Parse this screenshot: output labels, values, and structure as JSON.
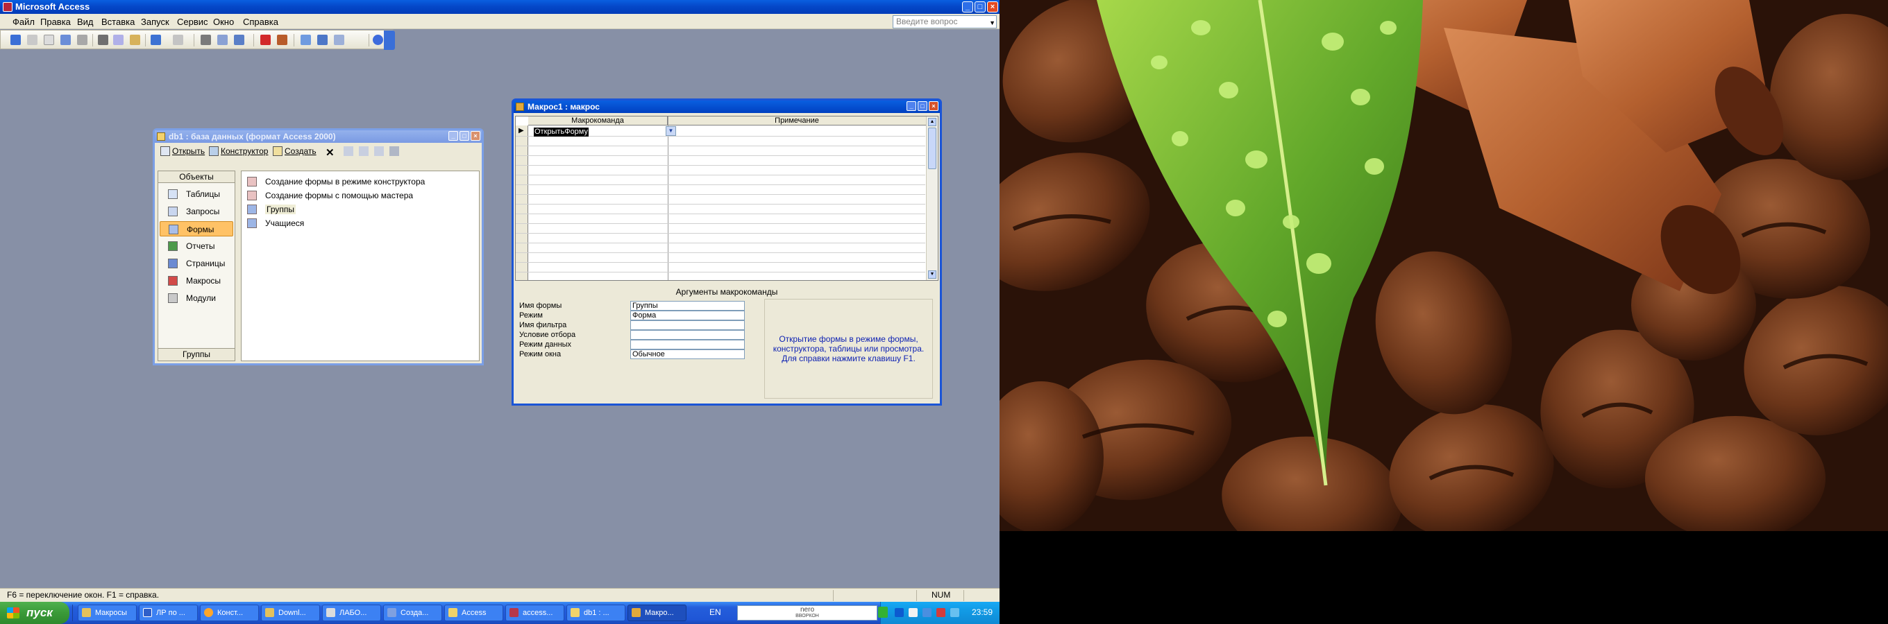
{
  "app": {
    "title": "Microsoft Access"
  },
  "menubar": {
    "items": [
      "Файл",
      "Правка",
      "Вид",
      "Вставка",
      "Запуск",
      "Сервис",
      "Окно",
      "Справка"
    ],
    "help_placeholder": "Введите вопрос"
  },
  "db_window": {
    "title": "db1 : база данных (формат Access 2000)",
    "toolbar": {
      "open": "Открыть",
      "design": "Конструктор",
      "create": "Создать"
    },
    "objects_header": "Объекты",
    "objects": [
      "Таблицы",
      "Запросы",
      "Формы",
      "Отчеты",
      "Страницы",
      "Макросы",
      "Модули"
    ],
    "selected_object": "Формы",
    "groups_label": "Группы",
    "items": [
      "Создание формы в режиме конструктора",
      "Создание формы с помощью мастера",
      "Группы",
      "Учащиеся"
    ]
  },
  "macro_window": {
    "title": "Макрос1 : макрос",
    "col_action": "Макрокоманда",
    "col_note": "Примечание",
    "first_action": "ОткрытьФорму",
    "args_label": "Аргументы макрокоманды",
    "args": [
      {
        "label": "Имя формы",
        "value": "Группы"
      },
      {
        "label": "Режим",
        "value": "Форма"
      },
      {
        "label": "Имя фильтра",
        "value": ""
      },
      {
        "label": "Условие отбора",
        "value": ""
      },
      {
        "label": "Режим данных",
        "value": ""
      },
      {
        "label": "Режим окна",
        "value": "Обычное"
      }
    ],
    "hint": "Открытие формы в режиме формы, конструктора, таблицы или просмотра. Для справки нажмите клавишу F1."
  },
  "statusbar": {
    "text": "F6 = переключение окон.  F1 = справка.",
    "num": "NUM"
  },
  "taskbar": {
    "start": "пуск",
    "tasks": [
      "Макросы",
      "ЛР по ...",
      "Конст...",
      "Downl...",
      "ЛАБО...",
      "Созда...",
      "Access",
      "access...",
      "db1 : ...",
      "Макро..."
    ],
    "lang": "EN",
    "nero": "nero",
    "nero_sub": "ВВОРКОН",
    "time": "23:59"
  },
  "colors": {
    "desktop": "#8790a6",
    "titlebar": "#0548c9",
    "taskbar": "#245edb",
    "start": "#3a9a38",
    "selection": "#ffc266"
  }
}
